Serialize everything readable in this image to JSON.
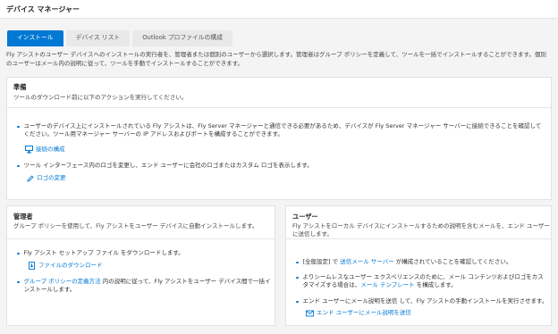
{
  "header": {
    "title": "デバイス マネージャー"
  },
  "tabs": [
    {
      "label": "インストール",
      "active": true
    },
    {
      "label": "デバイス リスト",
      "active": false
    },
    {
      "label": "Outlook プロファイルの構成",
      "active": false
    }
  ],
  "intro": "Fly アシストのユーザー デバイスへのインストールの実行者を、管理者または個別のユーザーから選択します。管理者はグループ ポリシーを定義して、ツールを一括でインストールすることができます。個別のユーザーはメール内の説明に従って、ツールを手動でインストールすることができます。",
  "prep": {
    "title": "準備",
    "subtitle": "ツールのダウンロード前に以下のアクションを実行してください。",
    "item1": "ユーザーのデバイス上にインストールされている Fly アシストは、Fly Server マネージャーと通信できる必要があるため、デバイスが Fly Server マネージャー サーバーに接続できることを確認してください。ツール用マネージャー サーバーの IP アドレスおよびポートを構成することができます。",
    "item1_action": "接続の構成",
    "item2": "ツール インターフェース内のロゴを変更し、エンド ユーザーに会社のロゴまたはカスタム ロゴを表示します。",
    "item2_action": "ロゴの変更"
  },
  "admin": {
    "title": "管理者",
    "subtitle": "グループ ポリシーを使用して、Fly アシストをユーザー デバイスに自動インストールします。",
    "item1": "Fly アシスト セットアップ ファイル をダウンロードします。",
    "item1_action": "ファイルのダウンロード",
    "item2_link": "グループ ポリシーの定義方法",
    "item2_text": " 内の説明に従って、Fly アシストをユーザー デバイス間で一括インストールします。"
  },
  "user": {
    "title": "ユーザー",
    "subtitle": "Fly アシストをローカル デバイスにインストールするための説明を含むメールを、エンド ユーザーに送信します。",
    "item1_pre": "[全般設定] で ",
    "item1_link": "送信メール サーバー",
    "item1_post": " が構成されていることを確認してください。",
    "item2_pre": "よりシームレスなユーザー エクスペリエンスのために、メール コンテンツおよびロゴをカスタマイズする場合は、",
    "item2_link": "メール テンプレート",
    "item2_post": " を構成します。",
    "item3": "エンド ユーザーにメール説明を送信 して、Fly アシストの手動インストールを実行させます。",
    "item3_action": "エンド ユーザーにメール説明を送信"
  }
}
